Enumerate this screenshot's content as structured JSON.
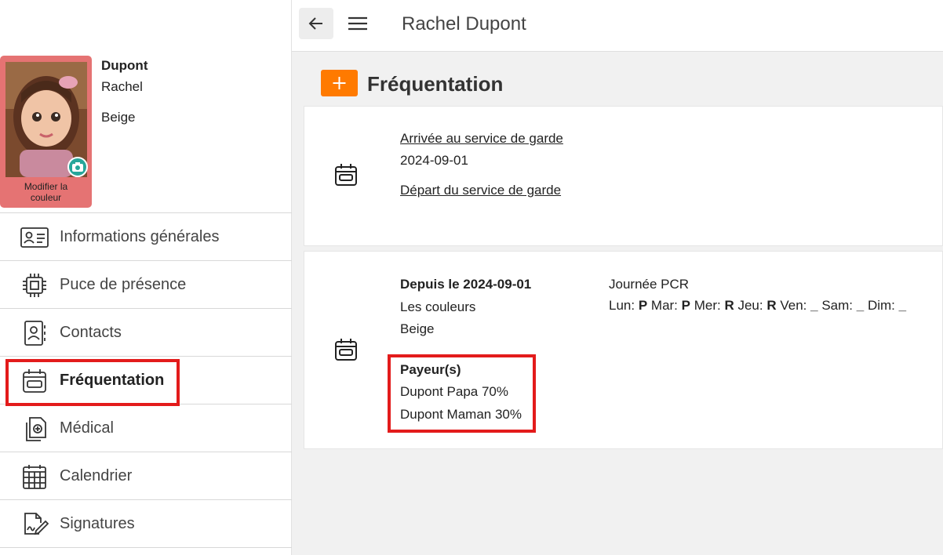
{
  "topbar": {
    "title": "Rachel Dupont"
  },
  "profile": {
    "last_name": "Dupont",
    "first_name": "Rachel",
    "group": "Beige",
    "photo_caption": "Modifier la\ncouleur",
    "card_color": "#e57373"
  },
  "nav": {
    "items": [
      {
        "label": "Informations générales",
        "icon": "id-card-icon"
      },
      {
        "label": "Puce de présence",
        "icon": "chip-icon"
      },
      {
        "label": "Contacts",
        "icon": "contact-book-icon"
      },
      {
        "label": "Fréquentation",
        "icon": "calendar-icon",
        "active": true
      },
      {
        "label": "Médical",
        "icon": "medical-files-icon"
      },
      {
        "label": "Calendrier",
        "icon": "calendar-grid-icon"
      },
      {
        "label": "Signatures",
        "icon": "signature-icon"
      }
    ]
  },
  "section": {
    "title": "Fréquentation",
    "add_icon": "plus-icon",
    "accent": "#ff7a00"
  },
  "card1": {
    "arrival_label": "Arrivée au service de garde",
    "arrival_date": "2024-09-01",
    "departure_label": "Départ du service de garde"
  },
  "card2": {
    "since": "Depuis le 2024-09-01",
    "group_name": "Les couleurs",
    "color": "Beige",
    "day_type": "Journée PCR",
    "schedule": [
      {
        "day": "Lun:",
        "code": "P"
      },
      {
        "day": "Mar:",
        "code": "P"
      },
      {
        "day": "Mer:",
        "code": "R"
      },
      {
        "day": "Jeu:",
        "code": "R"
      },
      {
        "day": "Ven:",
        "code": "_"
      },
      {
        "day": "Sam:",
        "code": "_"
      },
      {
        "day": "Dim:",
        "code": "_"
      }
    ],
    "payers_title": "Payeur(s)",
    "payers": [
      "Dupont Papa 70%",
      "Dupont Maman 30%"
    ]
  },
  "highlight_color": "#e31b1b"
}
